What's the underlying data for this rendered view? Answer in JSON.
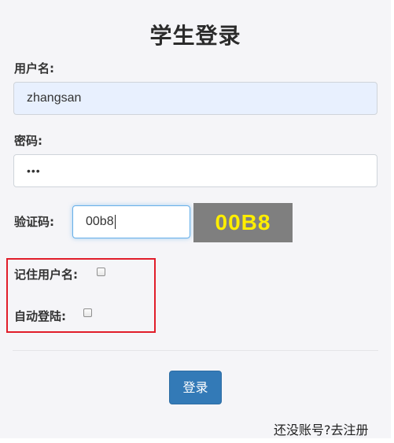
{
  "page": {
    "title": "学生登录"
  },
  "username": {
    "label": "用户名:",
    "value": "zhangsan"
  },
  "password": {
    "label": "密码:",
    "masked_value": "•••"
  },
  "captcha": {
    "label": "验证码:",
    "value": "00b8",
    "image_text": "00B8"
  },
  "options": {
    "remember_label": "记住用户名:",
    "auto_login_label": "自动登陆:"
  },
  "actions": {
    "login_label": "登录",
    "register_link": "还没账号?去注册"
  },
  "colors": {
    "highlight_border": "#e11d2a",
    "button_bg": "#337ab7",
    "captcha_bg": "#7f7f7f",
    "captcha_text": "#ffee00"
  }
}
